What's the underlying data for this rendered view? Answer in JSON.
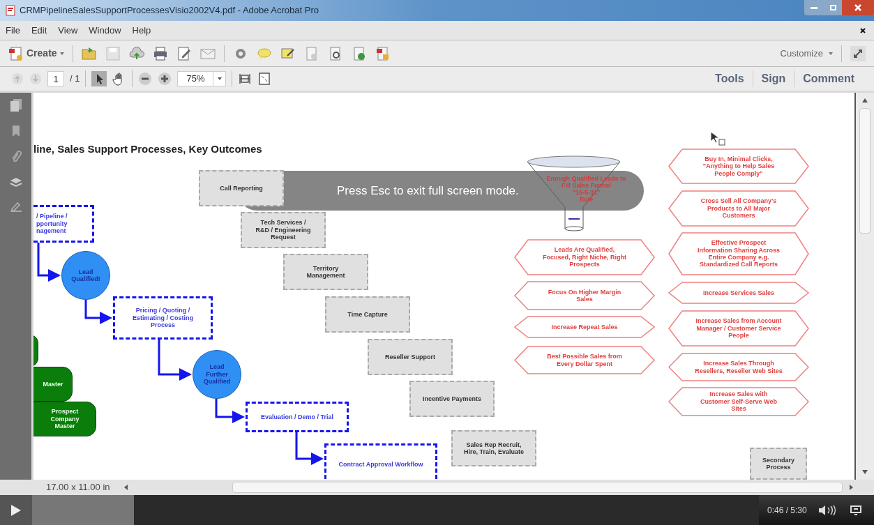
{
  "window": {
    "title": "CRMPipelineSalesSupportProcessesVisio2002V4.pdf - Adobe Acrobat Pro"
  },
  "menu": [
    "File",
    "Edit",
    "View",
    "Window",
    "Help"
  ],
  "toolbar": {
    "create": "Create",
    "customize": "Customize"
  },
  "navigation": {
    "page": "1",
    "page_total": "/ 1",
    "zoom": "75%",
    "panels": [
      "Tools",
      "Sign",
      "Comment"
    ]
  },
  "document": {
    "title": "line, Sales Support Processes, Key Outcomes",
    "nodes": [
      {
        "kind": "process",
        "text": "/ Pipeline /\npportunity\nnagement"
      },
      {
        "kind": "decision",
        "text": "Lead\nQualified!"
      },
      {
        "kind": "process",
        "text": "Pricing / Quoting /\nEstimating / Costing\nProcess"
      },
      {
        "kind": "decision",
        "text": "Lead\nFurther\nQualified"
      },
      {
        "kind": "process",
        "text": "Evaluation / Demo / Trial"
      },
      {
        "kind": "process",
        "text": "Contract Approval Workflow"
      },
      {
        "kind": "database",
        "text": "Master"
      },
      {
        "kind": "database",
        "text": "Prospect\nCompany\nMaster"
      },
      {
        "kind": "support",
        "text": "Call Reporting"
      },
      {
        "kind": "support",
        "text": "Tech Services /\nR&D / Engineering\nRequest"
      },
      {
        "kind": "support",
        "text": "Territory\nManagement"
      },
      {
        "kind": "support",
        "text": "Time Capture"
      },
      {
        "kind": "support",
        "text": "Reseller Support"
      },
      {
        "kind": "support",
        "text": "Incentive Payments"
      },
      {
        "kind": "support",
        "text": "Sales Rep Recruit,\nHire, Train, Evaluate"
      },
      {
        "kind": "support",
        "text": "Secondary\nProcess"
      },
      {
        "kind": "funnel",
        "text": "Enough Qualified  Leads to\nFill Sales Funnel\n\"15-5-31\"\nRule"
      },
      {
        "kind": "outcome",
        "text": "Leads Are Qualified,\nFocused, Right Niche, Right\nProspects"
      },
      {
        "kind": "outcome",
        "text": "Focus On Higher Margin\nSales"
      },
      {
        "kind": "outcome",
        "text": "Increase Repeat Sales"
      },
      {
        "kind": "outcome",
        "text": "Best Possible Sales from\nEvery Dollar Spent"
      },
      {
        "kind": "outcome",
        "text": "Buy In, Minimal Clicks,\n\"Anything to Help Sales\nPeople Comply\""
      },
      {
        "kind": "outcome",
        "text": "Cross Sell All Company's\nProducts to All Major\nCustomers"
      },
      {
        "kind": "outcome",
        "text": "Effective Prospect\nInformation Sharing Across\nEntire Company e.g.\nStandardized Call Reports"
      },
      {
        "kind": "outcome",
        "text": "Increase Services Sales"
      },
      {
        "kind": "outcome",
        "text": "Increase Sales from Account\nManager / Customer Service\nPeople"
      },
      {
        "kind": "outcome",
        "text": "Increase Sales Through\nResellers, Reseller Web Sites"
      },
      {
        "kind": "outcome",
        "text": "Increase Sales with\nCustomer Self-Serve Web\nSites"
      }
    ]
  },
  "page_size": "17.00 x 11.00 in",
  "fullscreen_notice": "Press Esc to exit full screen mode.",
  "player": {
    "level": 0.14,
    "time": "0:46 / 5:30"
  }
}
